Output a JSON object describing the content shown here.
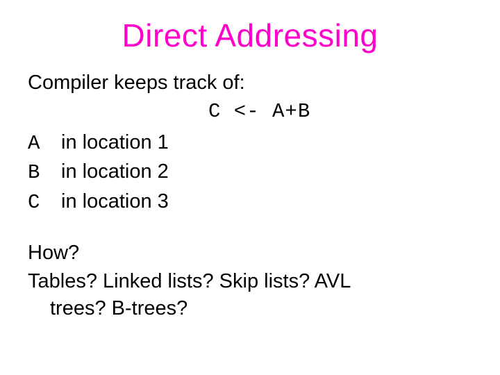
{
  "title": "Direct Addressing",
  "intro": "Compiler keeps track of:",
  "code": "C <- A+B",
  "locations": [
    {
      "sym": "A",
      "text": "in location  1"
    },
    {
      "sym": "B",
      "text": "in location  2"
    },
    {
      "sym": "C",
      "text": "in location  3"
    }
  ],
  "how": "How?",
  "ds_line1": "Tables? Linked lists? Skip lists? AVL",
  "ds_line2": "trees? B-trees?"
}
